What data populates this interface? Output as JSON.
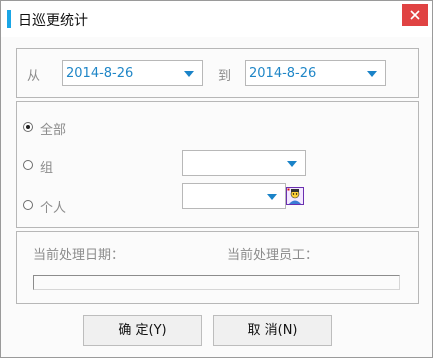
{
  "window": {
    "title": "日巡更统计"
  },
  "date_range": {
    "from_label": "从",
    "from_value": "2014-8-26",
    "to_label": "到",
    "to_value": "2014-8-26"
  },
  "scope": {
    "options": [
      {
        "label": "全部",
        "checked": true
      },
      {
        "label": "组",
        "checked": false
      },
      {
        "label": "个人",
        "checked": false
      }
    ],
    "group_value": "",
    "person_value": ""
  },
  "status": {
    "date_label": "当前处理日期：",
    "staff_label": "当前处理员工：",
    "progress": 0
  },
  "buttons": {
    "ok": "确  定(Y)",
    "cancel": "取  消(N)"
  },
  "colors": {
    "accent": "#1aa6e6",
    "close": "#e04343",
    "value_text": "#1f86c7"
  },
  "icons": {
    "close": "close-icon",
    "person": "person-icon",
    "dropdown": "chevron-down-icon"
  }
}
